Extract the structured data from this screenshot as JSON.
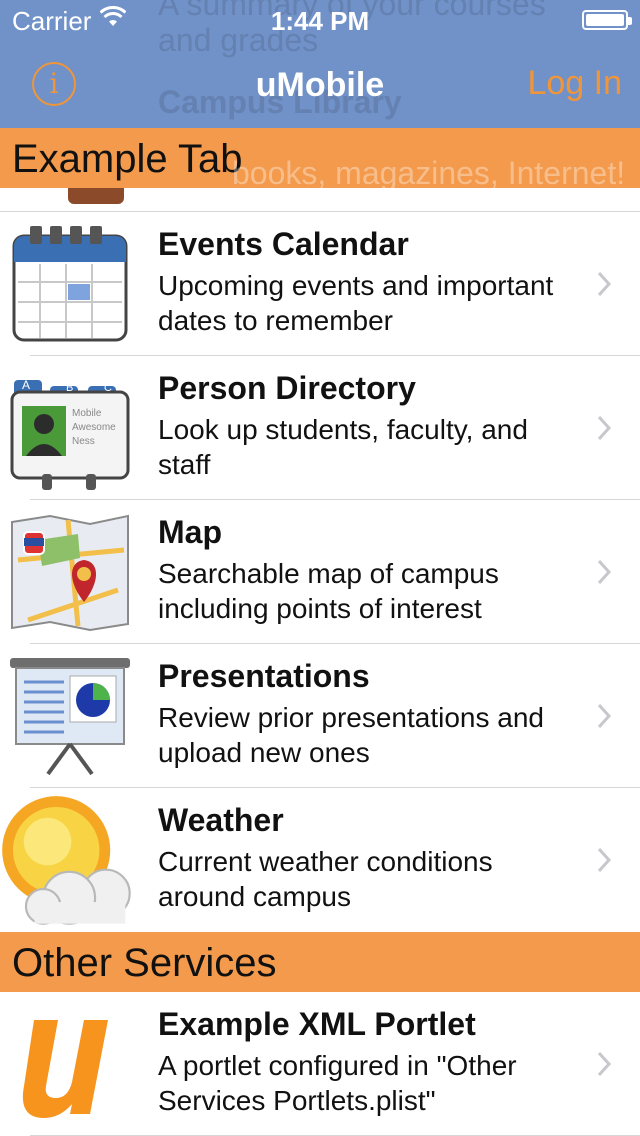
{
  "status_bar": {
    "carrier": "Carrier",
    "time": "1:44 PM"
  },
  "nav": {
    "title": "uMobile",
    "login_label": "Log In",
    "info_symbol": "i"
  },
  "ghost": {
    "line1": "A summary of your courses",
    "line2": "and grades",
    "line3": "Campus Library",
    "line4": "books, magazines, Internet!"
  },
  "sections": [
    {
      "header": "Example Tab",
      "items": [
        {
          "title": "Events Calendar",
          "desc": "Upcoming events and important dates to remember",
          "icon": "calendar-icon"
        },
        {
          "title": "Person Directory",
          "desc": "Look up students, faculty, and staff",
          "icon": "directory-icon"
        },
        {
          "title": "Map",
          "desc": "Searchable map of campus including points of interest",
          "icon": "map-icon"
        },
        {
          "title": "Presentations",
          "desc": "Review prior presentations and upload new ones",
          "icon": "presentation-icon"
        },
        {
          "title": "Weather",
          "desc": "Current weather conditions around campus",
          "icon": "weather-icon"
        }
      ]
    },
    {
      "header": "Other Services",
      "items": [
        {
          "title": "Example XML Portlet",
          "desc": "A portlet configured in \"Other Services Portlets.plist\"",
          "icon": "umobile-logo-icon"
        }
      ]
    }
  ],
  "directory_card_text": {
    "line1": "Mobile",
    "line2": "Awesome",
    "line3": "Ness",
    "tab_a": "A",
    "tab_b": "B",
    "tab_c": "C"
  },
  "colors": {
    "nav_bar": "#7092c8",
    "accent_orange": "#f0953a",
    "section_header": "#f39a4c",
    "separator": "#d6d6d6"
  }
}
